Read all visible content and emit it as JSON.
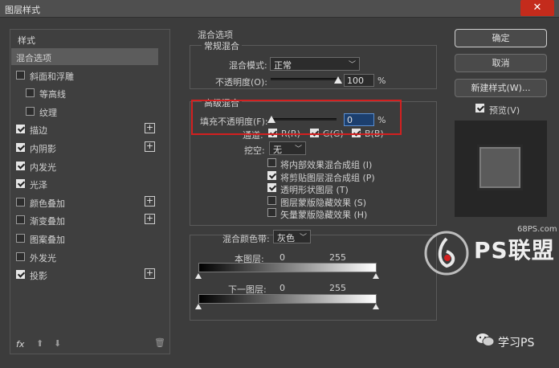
{
  "window": {
    "title": "图层样式",
    "close_glyph": "✕"
  },
  "left_panel": {
    "heading": "样式",
    "items": [
      {
        "label": "混合选项",
        "checkbox": false,
        "checked": false,
        "plus": false,
        "selected": true,
        "indent": false
      },
      {
        "label": "斜面和浮雕",
        "checkbox": true,
        "checked": false,
        "plus": false,
        "selected": false,
        "indent": false
      },
      {
        "label": "等高线",
        "checkbox": true,
        "checked": false,
        "plus": false,
        "selected": false,
        "indent": true
      },
      {
        "label": "纹理",
        "checkbox": true,
        "checked": false,
        "plus": false,
        "selected": false,
        "indent": true
      },
      {
        "label": "描边",
        "checkbox": true,
        "checked": true,
        "plus": true,
        "selected": false,
        "indent": false
      },
      {
        "label": "内阴影",
        "checkbox": true,
        "checked": true,
        "plus": true,
        "selected": false,
        "indent": false
      },
      {
        "label": "内发光",
        "checkbox": true,
        "checked": true,
        "plus": false,
        "selected": false,
        "indent": false
      },
      {
        "label": "光泽",
        "checkbox": true,
        "checked": true,
        "plus": false,
        "selected": false,
        "indent": false
      },
      {
        "label": "颜色叠加",
        "checkbox": true,
        "checked": false,
        "plus": true,
        "selected": false,
        "indent": false
      },
      {
        "label": "渐变叠加",
        "checkbox": true,
        "checked": false,
        "plus": true,
        "selected": false,
        "indent": false
      },
      {
        "label": "图案叠加",
        "checkbox": true,
        "checked": false,
        "plus": false,
        "selected": false,
        "indent": false
      },
      {
        "label": "外发光",
        "checkbox": true,
        "checked": false,
        "plus": false,
        "selected": false,
        "indent": false
      },
      {
        "label": "投影",
        "checkbox": true,
        "checked": true,
        "plus": true,
        "selected": false,
        "indent": false
      }
    ],
    "fx_label": "fx"
  },
  "blend_options": {
    "section_title": "混合选项",
    "general": {
      "legend": "常规混合",
      "mode_label": "混合模式:",
      "mode_value": "正常",
      "opacity_label": "不透明度(O):",
      "opacity_value": "100",
      "opacity_unit": "%"
    },
    "advanced": {
      "legend": "高级混合",
      "fill_label": "填充不透明度(F):",
      "fill_value": "0",
      "fill_unit": "%",
      "channels_label": "通道:",
      "channel_r": "R(R)",
      "channel_g": "G(G)",
      "channel_b": "B(B)",
      "knockout_label": "挖空:",
      "knockout_value": "无",
      "options": [
        {
          "label": "将内部效果混合成组 (I)",
          "checked": false
        },
        {
          "label": "将剪贴图层混合成组 (P)",
          "checked": true
        },
        {
          "label": "透明形状图层 (T)",
          "checked": true
        },
        {
          "label": "图层蒙版隐藏效果 (S)",
          "checked": false
        },
        {
          "label": "矢量蒙版隐藏效果 (H)",
          "checked": false
        }
      ]
    },
    "blend_if": {
      "label": "混合颜色带:",
      "value": "灰色",
      "this_layer": "本图层:",
      "this_min": "0",
      "this_max": "255",
      "under_layer": "下一图层:",
      "under_min": "0",
      "under_max": "255"
    }
  },
  "buttons": {
    "ok": "确定",
    "cancel": "取消",
    "new_style": "新建样式(W)...",
    "preview": "预览(V)"
  },
  "watermarks": {
    "site": "68PS.com",
    "brand": "PS联盟",
    "account": "学习PS"
  },
  "colors": {
    "highlight_box": "#d32020",
    "close_button": "#c42b1c"
  }
}
